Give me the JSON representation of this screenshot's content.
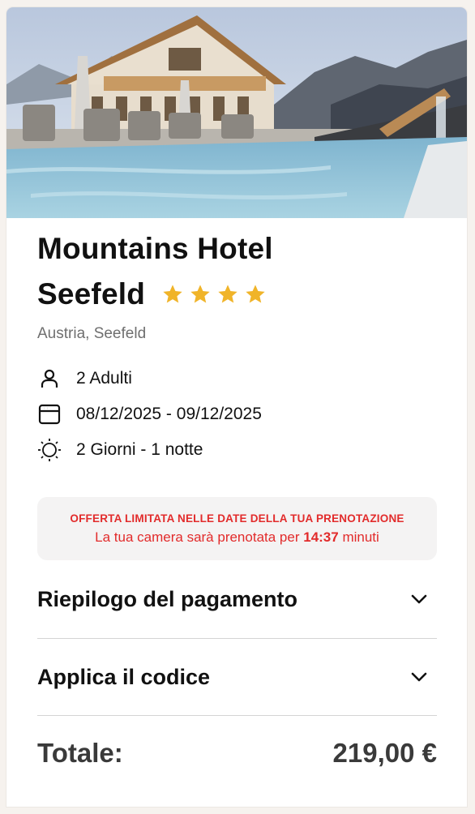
{
  "hotel": {
    "name_line1": "Mountains Hotel",
    "name_line2": "Seefeld",
    "stars": 4,
    "location": "Austria, Seefeld",
    "image_alt": "hotel-pool-photo"
  },
  "booking": {
    "guests": "2 Adulti",
    "dates": "08/12/2025 - 09/12/2025",
    "duration": "2 Giorni - 1 notte"
  },
  "offer": {
    "headline": "OFFERTA LIMITATA NELLE DATE DELLA TUA PRENOTAZIONE",
    "text_before": "La tua camera sarà prenotata per",
    "countdown": "14:37",
    "text_after": "minuti"
  },
  "accordion": [
    {
      "label": "Riepilogo del pagamento"
    },
    {
      "label": "Applica il codice"
    }
  ],
  "total": {
    "label": "Totale:",
    "value": "219,00 €"
  },
  "colors": {
    "star": "#f0b429",
    "offer_red": "#e22b2b"
  },
  "icons": [
    "user-icon",
    "calendar-icon",
    "sun-icon",
    "chevron-down-icon",
    "star-icon"
  ]
}
